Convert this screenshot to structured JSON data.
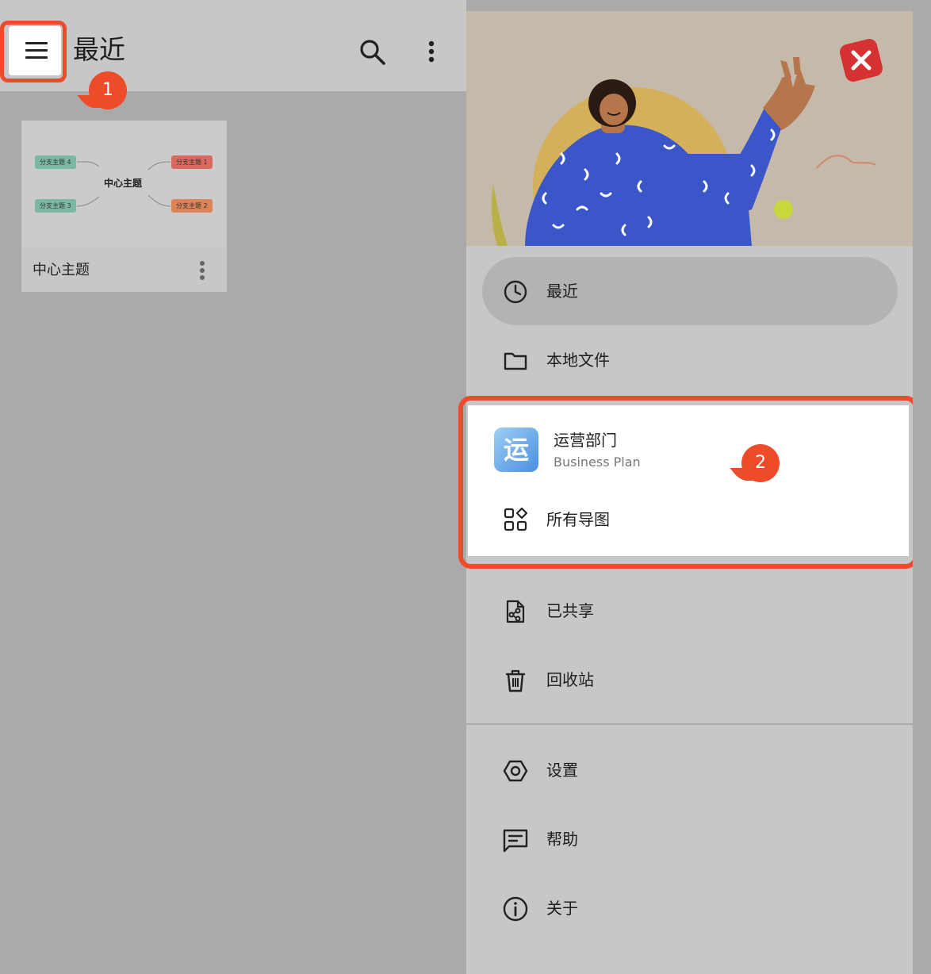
{
  "app_bar": {
    "title": "最近",
    "menu_icon": "hamburger-menu-icon",
    "search_icon": "search-icon",
    "more_icon": "more-vertical-icon"
  },
  "annotations": {
    "badge_1": "1",
    "badge_2": "2",
    "highlight_color": "#ee4b2b"
  },
  "recent_files": [
    {
      "title": "中心主题",
      "thumbnail": {
        "center": "中心主题",
        "branches": [
          "分支主题 1",
          "分支主题 2",
          "分支主题 3",
          "分支主题 4"
        ]
      }
    }
  ],
  "drawer": {
    "items": [
      {
        "label": "最近",
        "icon": "clock-icon",
        "active": true
      },
      {
        "label": "本地文件",
        "icon": "folder-icon",
        "active": false
      }
    ],
    "team": {
      "avatar_text": "运",
      "name": "运营部门",
      "plan": "Business Plan",
      "all_maps_label": "所有导图",
      "all_maps_icon": "grid-shapes-icon"
    },
    "items_after_team": [
      {
        "label": "已共享",
        "icon": "shared-file-icon"
      },
      {
        "label": "回收站",
        "icon": "trash-icon"
      }
    ],
    "footer_items": [
      {
        "label": "设置",
        "icon": "settings-icon"
      },
      {
        "label": "帮助",
        "icon": "help-message-icon"
      },
      {
        "label": "关于",
        "icon": "info-icon"
      }
    ]
  },
  "colors": {
    "accent": "#ee4b2b",
    "app_bar_bg": "#c7c7c7",
    "scrim_bg": "#aaaaaa",
    "drawer_bg": "#c7c7c7",
    "active_item_bg": "#b3b3b3"
  }
}
